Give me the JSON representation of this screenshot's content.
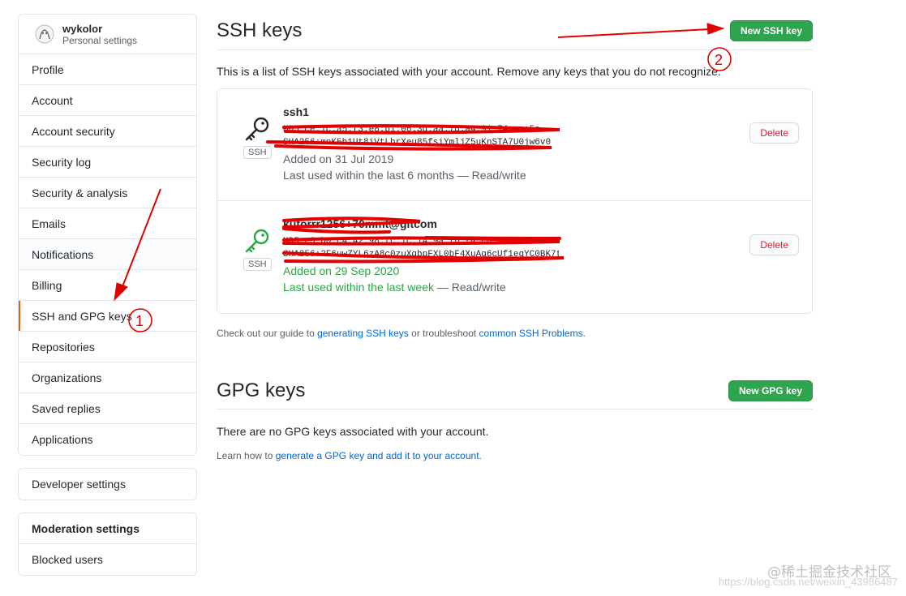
{
  "sidebar": {
    "username": "wykolor",
    "subtitle": "Personal settings",
    "items": [
      {
        "label": "Profile"
      },
      {
        "label": "Account"
      },
      {
        "label": "Account security"
      },
      {
        "label": "Security log"
      },
      {
        "label": "Security & analysis"
      },
      {
        "label": "Emails"
      },
      {
        "label": "Notifications"
      },
      {
        "label": "Billing"
      },
      {
        "label": "SSH and GPG keys"
      },
      {
        "label": "Repositories"
      },
      {
        "label": "Organizations"
      },
      {
        "label": "Saved replies"
      },
      {
        "label": "Applications"
      }
    ],
    "developer_settings": "Developer settings",
    "moderation_title": "Moderation settings",
    "blocked_users": "Blocked users"
  },
  "ssh": {
    "title": "SSH keys",
    "new_button": "New SSH key",
    "description": "This is a list of SSH keys associated with your account. Remove any keys that you do not recognize.",
    "keys": [
      {
        "title": "ssh1",
        "fingerprint_line1": "MD5:ce:1c:a5:f3:e8:b1:06:3d:aa:7d:a4:91:74:ce:5e",
        "fingerprint_line2": "SHA256:mnK5h1Ut8iVtLbrXeu85fsiYmljZ5uKnSTA7U0jw6v0",
        "badge": "SSH",
        "added": "Added on 31 Jul 2019",
        "used_prefix": "Last used within the last 6 months",
        "used_suffix": " — Read/write",
        "delete": "Delete",
        "icon_color": "#24292e"
      },
      {
        "title": "kutorrr1256+70mmt@gitcom",
        "fingerprint_line1": "MD5:e3:b0:c4:42:98:fc:1c:14:9a:fb:f4:c8:99:6f:b9:24",
        "fingerprint_line2": "SHA256:2F6uwZYL6zA8c0zuXqbpFXL0bF4XuAq6cUf1eqYC0BK7t8",
        "badge": "SSH",
        "added": "Added on 29 Sep 2020",
        "used_prefix": "Last used within the last week",
        "used_suffix": " — Read/write",
        "delete": "Delete",
        "icon_color": "#28a745"
      }
    ],
    "help_prefix": "Check out our guide to ",
    "help_link1": "generating SSH keys",
    "help_middle": " or troubleshoot ",
    "help_link2": "common SSH Problems",
    "help_suffix": "."
  },
  "gpg": {
    "title": "GPG keys",
    "new_button": "New GPG key",
    "empty": "There are no GPG keys associated with your account.",
    "learn_prefix": "Learn how to ",
    "learn_link": "generate a GPG key and add it to your account",
    "learn_suffix": "."
  },
  "annotations": {
    "marker1": "1",
    "marker2": "2"
  },
  "watermark": {
    "main": "@稀土掘金技术社区",
    "url": "https://blog.csdn.net/weixin_43986487"
  },
  "colors": {
    "primary_button": "#2ea44f",
    "delete_text": "#cb2431",
    "link": "#0366d6",
    "annotation_red": "#e00000"
  }
}
